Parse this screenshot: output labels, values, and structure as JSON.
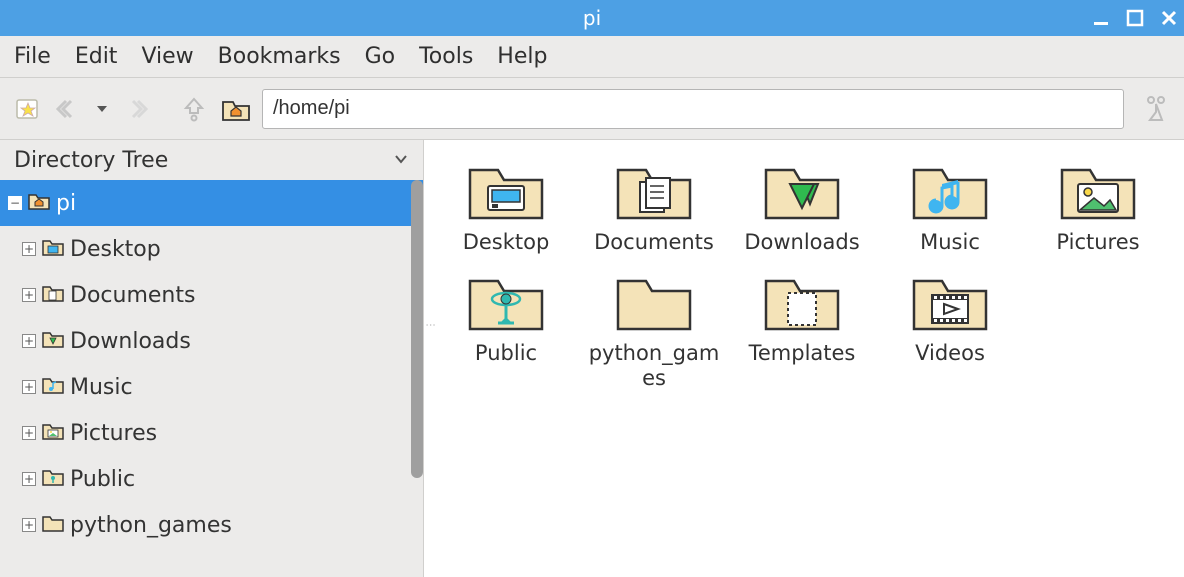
{
  "window": {
    "title": "pi"
  },
  "menubar": [
    "File",
    "Edit",
    "View",
    "Bookmarks",
    "Go",
    "Tools",
    "Help"
  ],
  "toolbar": {
    "path": "/home/pi"
  },
  "sidepanel": {
    "title": "Directory Tree",
    "root": {
      "label": "pi",
      "expanded": true
    },
    "children": [
      {
        "label": "Desktop",
        "icon": "desktop"
      },
      {
        "label": "Documents",
        "icon": "documents"
      },
      {
        "label": "Downloads",
        "icon": "downloads"
      },
      {
        "label": "Music",
        "icon": "music"
      },
      {
        "label": "Pictures",
        "icon": "pictures"
      },
      {
        "label": "Public",
        "icon": "public"
      },
      {
        "label": "python_games",
        "icon": "folder"
      }
    ]
  },
  "folders": [
    {
      "label": "Desktop",
      "icon": "desktop"
    },
    {
      "label": "Documents",
      "icon": "documents"
    },
    {
      "label": "Downloads",
      "icon": "downloads"
    },
    {
      "label": "Music",
      "icon": "music"
    },
    {
      "label": "Pictures",
      "icon": "pictures"
    },
    {
      "label": "Public",
      "icon": "public"
    },
    {
      "label": "python_games",
      "icon": "folder"
    },
    {
      "label": "Templates",
      "icon": "templates"
    },
    {
      "label": "Videos",
      "icon": "videos"
    }
  ]
}
